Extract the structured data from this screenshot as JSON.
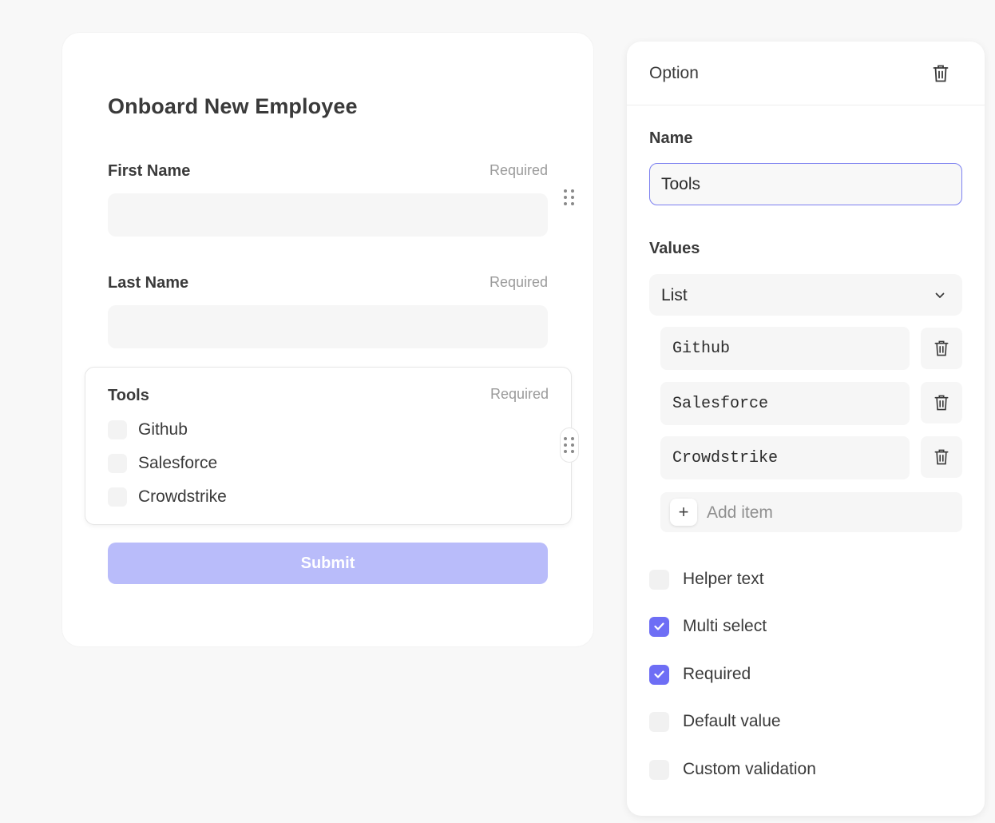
{
  "form": {
    "title": "Onboard New Employee",
    "fields": [
      {
        "label": "First Name",
        "required_label": "Required",
        "value": ""
      },
      {
        "label": "Last Name",
        "required_label": "Required",
        "value": ""
      }
    ],
    "tools": {
      "label": "Tools",
      "required_label": "Required",
      "options": [
        "Github",
        "Salesforce",
        "Crowdstrike"
      ]
    },
    "submit_label": "Submit"
  },
  "panel": {
    "title": "Option",
    "name_label": "Name",
    "name_value": "Tools",
    "values_label": "Values",
    "values_type": "List",
    "items": [
      "Github",
      "Salesforce",
      "Crowdstrike"
    ],
    "add_item_label": "Add item",
    "settings": [
      {
        "label": "Helper text",
        "checked": false
      },
      {
        "label": "Multi select",
        "checked": true
      },
      {
        "label": "Required",
        "checked": true
      },
      {
        "label": "Default value",
        "checked": false
      },
      {
        "label": "Custom validation",
        "checked": false
      }
    ]
  },
  "icons": {
    "delete": "trash-icon",
    "drag": "drag-handle-icon",
    "dropdown": "chevron-down-icon",
    "add": "plus-icon",
    "checked": "check-icon"
  },
  "colors": {
    "accent": "#6e6ef5",
    "focus_border": "#7b7ff0",
    "submit_disabled": "#b9bcfa"
  }
}
